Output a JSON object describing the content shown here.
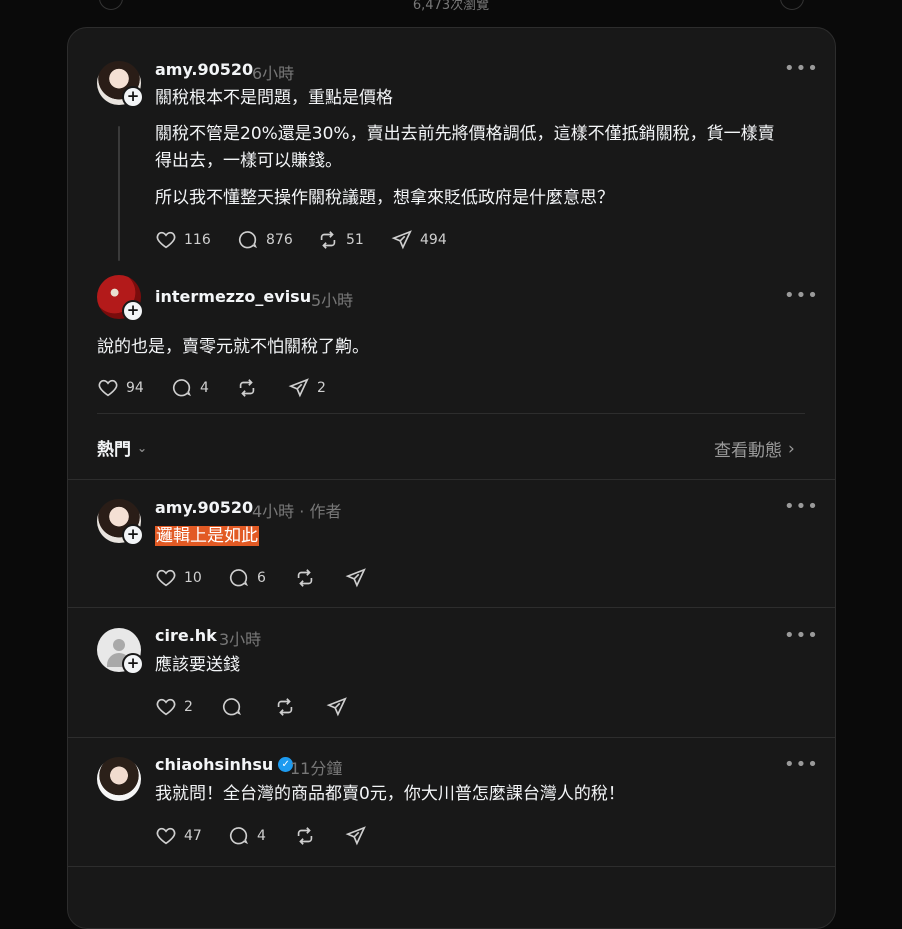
{
  "header": {
    "views_text": "6,473次瀏覽"
  },
  "posts": [
    {
      "username": "amy.90520",
      "time": "6小時",
      "lines": [
        "關稅根本不是問題，重點是價格",
        "關稅不管是20%還是30%，賣出去前先將價格調低，這樣不僅抵銷關稅，貨一樣賣",
        "得出去，一樣可以賺錢。",
        "所以我不懂整天操作關稅議題，想拿來貶低政府是什麼意思？"
      ],
      "likes": "116",
      "replies": "876",
      "reposts": "51",
      "shares": "494"
    },
    {
      "username": "intermezzo_evisu",
      "time": "5小時",
      "text": "說的也是，賣零元就不怕關稅了齁。",
      "likes": "94",
      "replies": "4",
      "reposts": "",
      "shares": "2"
    }
  ],
  "sort": {
    "label": "熱門",
    "activity_link": "查看動態"
  },
  "replies": [
    {
      "username": "amy.90520",
      "time": "4小時",
      "author_tag": "· 作者",
      "text": "邏輯上是如此",
      "likes": "10",
      "replies": "6"
    },
    {
      "username": "cire.hk",
      "time": "3小時",
      "text": "應該要送錢",
      "likes": "2",
      "replies": ""
    },
    {
      "username": "chiaohsinhsu",
      "verified": true,
      "time": "11分鐘",
      "text": "我就問！全台灣的商品都賣0元，你大川普怎麼課台灣人的稅！",
      "likes": "47",
      "replies": "4"
    }
  ],
  "icons": {
    "like": "heart-icon",
    "reply": "comment-icon",
    "repost": "repost-icon",
    "share": "send-icon",
    "more": "more-icon",
    "follow": "plus-icon"
  },
  "colors": {
    "background": "#0a0a0a",
    "card": "#181818",
    "highlight": "#e25a24",
    "verified": "#1d9bf0"
  }
}
